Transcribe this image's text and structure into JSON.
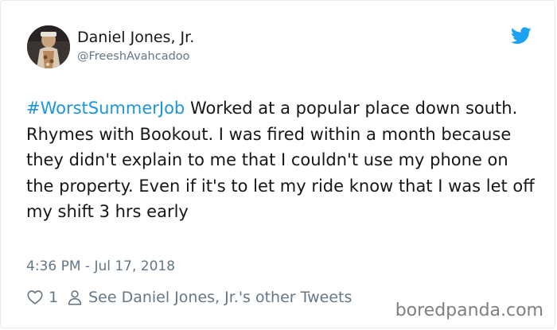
{
  "tweet": {
    "display_name": "Daniel Jones, Jr.",
    "handle": "@FreeshAvahcadoo",
    "hashtag": "#WorstSummerJob",
    "body": " Worked at a popular place down south. Rhymes with Bookout. I was fired within a month because they didn't explain to me that I couldn't use my phone on the property. Even if it's to let my ride know that I was let off my shift 3 hrs early",
    "timestamp": "4:36 PM - Jul 17, 2018",
    "like_count": "1",
    "other_tweets_label": "See Daniel Jones, Jr.'s other Tweets"
  },
  "icons": {
    "brand": "twitter-bird-icon",
    "like": "heart-icon",
    "profile": "person-icon"
  },
  "watermark": "boredpanda.com",
  "colors": {
    "hashtag": "#1b95e0",
    "twitter_blue": "#1da1f2",
    "secondary_text": "#657786",
    "primary_text": "#14171a",
    "watermark": "#7f7f7f"
  }
}
